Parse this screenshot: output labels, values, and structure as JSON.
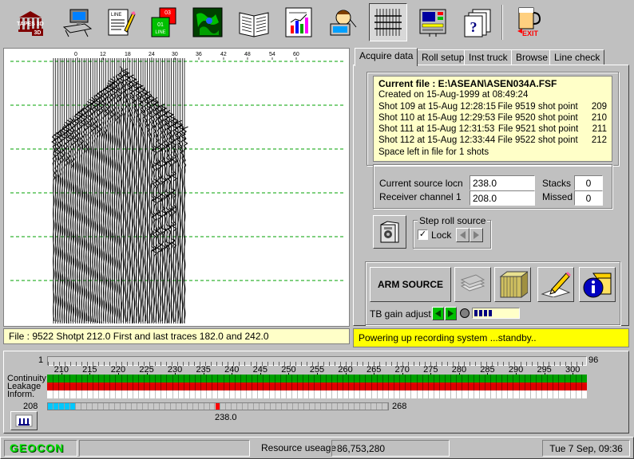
{
  "toolbar": {
    "items": [
      {
        "name": "tapes-3d-logo",
        "label": "TAPES 3D"
      },
      {
        "name": "computer-setup"
      },
      {
        "name": "line-notes",
        "label": "LINE"
      },
      {
        "name": "line-list",
        "label1": "03",
        "label2": "01",
        "label3": "LINE"
      },
      {
        "name": "map-view"
      },
      {
        "name": "survey-book"
      },
      {
        "name": "bar-chart"
      },
      {
        "name": "operator"
      },
      {
        "name": "seismic-display"
      },
      {
        "name": "recorder-panel"
      },
      {
        "name": "help-pages",
        "label": "?"
      },
      {
        "name": "exit",
        "label": "EXIT"
      }
    ]
  },
  "seismic": {
    "axis_labels": [
      "0",
      "12",
      "18",
      "24",
      "30",
      "36",
      "42",
      "48",
      "54",
      "60"
    ],
    "file_info": "File : 9522  Shotpt 212.0   First and last traces 182.0 and 242.0"
  },
  "tabs": [
    "Acquire data",
    "Roll setup",
    "Inst truck",
    "Browse",
    "Line check"
  ],
  "active_tab": "Acquire data",
  "current_file": {
    "header": "Current file : E:\\ASEAN\\ASEN034A.FSF",
    "created": "Created on 15-Aug-1999 at 08:49:24",
    "shots": [
      {
        "shot": "Shot 109 at 15-Aug  12:28:15",
        "file": "File  9519 shot point",
        "sp": "209"
      },
      {
        "shot": "Shot 110 at 15-Aug  12:29:53",
        "file": "File  9520 shot point",
        "sp": "210"
      },
      {
        "shot": "Shot 111 at 15-Aug  12:31:53",
        "file": "File  9521 shot point",
        "sp": "211"
      },
      {
        "shot": "Shot 112 at 15-Aug  12:33:44",
        "file": "File  9522 shot point",
        "sp": "212"
      }
    ],
    "space_left": "Space left in file for  1 shots"
  },
  "source": {
    "loc_label": "Current source locn",
    "loc_value": "238.0",
    "recv_label": "Receiver channel 1",
    "recv_value": "208.0",
    "stacks_label": "Stacks",
    "stacks_value": "0",
    "missed_label": "Missed",
    "missed_value": "0"
  },
  "roll": {
    "group_label": "Step roll source",
    "lock_label": "Lock",
    "lock_checked": true
  },
  "actions": {
    "arm_label": "ARM SOURCE",
    "tb_gain_label": "TB gain adjust"
  },
  "status_message": "Powering up recording system ...standby..",
  "strip": {
    "start_label": "1",
    "end_label": "96",
    "channel_ticks": [
      "210",
      "215",
      "220",
      "225",
      "230",
      "235",
      "240",
      "245",
      "250",
      "255",
      "260",
      "265",
      "270",
      "275",
      "280",
      "285",
      "290",
      "295",
      "300"
    ],
    "rows": [
      "Continuity",
      "Leakage",
      "Inform."
    ],
    "receiver_start": "208",
    "receiver_end": "268",
    "source_marker": "238.0"
  },
  "statusbar": {
    "logo": "GEOCON",
    "resource_label": "Resource useage",
    "resource_value": "86,753,280",
    "datetime": "Tue 7 Sep, 09:36"
  },
  "colors": {
    "continuity": "#00a000",
    "leakage": "#e00000",
    "panel_yellow": "#ffffc8",
    "status_yellow": "#ffff00",
    "geocon_green": "#00ff00",
    "receiver_cyan": "#00c8ff"
  }
}
